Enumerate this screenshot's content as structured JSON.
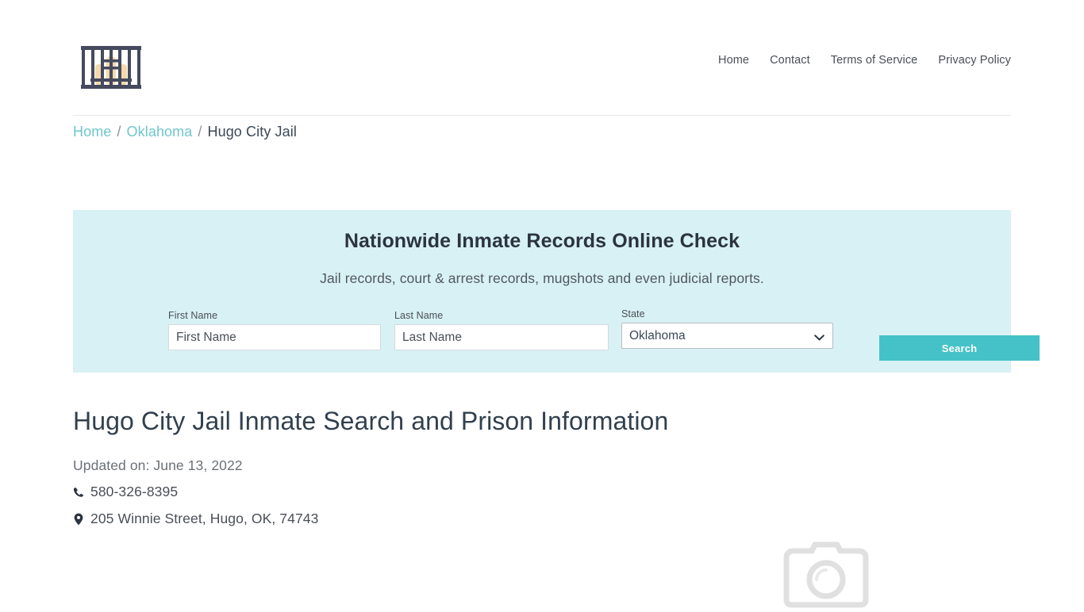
{
  "header": {
    "logo_alt": "jail-bars-logo",
    "nav": [
      {
        "label": "Home"
      },
      {
        "label": "Contact"
      },
      {
        "label": "Terms of Service"
      },
      {
        "label": "Privacy Policy"
      }
    ]
  },
  "breadcrumb": {
    "home": "Home",
    "state": "Oklahoma",
    "current": "Hugo City Jail",
    "separator": "/"
  },
  "banner": {
    "title": "Nationwide Inmate Records Online Check",
    "subtitle": "Jail records, court & arrest records, mugshots and even judicial reports.",
    "bg_color": "#d8f1f4",
    "form": {
      "first_name": {
        "label": "First Name",
        "placeholder": "First Name",
        "value": ""
      },
      "last_name": {
        "label": "Last Name",
        "placeholder": "Last Name",
        "value": ""
      },
      "state": {
        "label": "State",
        "selected": "Oklahoma"
      },
      "search_button": {
        "label": "Search",
        "color": "#45c2c8"
      }
    }
  },
  "main": {
    "title": "Hugo City Jail Inmate Search and Prison Information",
    "updated": "Updated on: June 13, 2022",
    "phone": "580-326-8395",
    "address": "205 Winnie Street, Hugo, OK, 74743",
    "phone_icon": "phone-icon",
    "address_icon": "map-pin-icon",
    "photo_placeholder_icon": "camera-icon"
  },
  "colors": {
    "accent": "#45c2c8",
    "link": "#6fc5cc",
    "banner_bg": "#d8f1f4",
    "text": "#3c4858"
  }
}
